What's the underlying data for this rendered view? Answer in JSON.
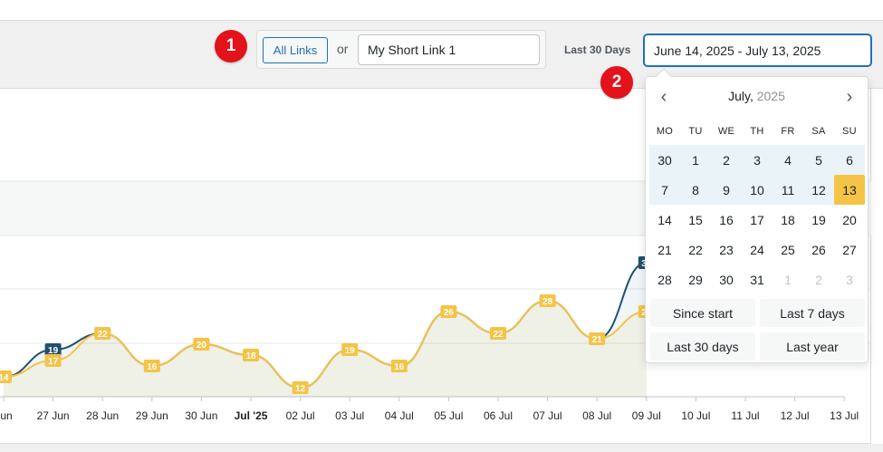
{
  "toolbar": {
    "marker_1": "1",
    "marker_2": "2",
    "all_links_label": "All Links",
    "or_label": "or",
    "link_input_value": "My Short Link 1",
    "range_label": "Last 30 Days",
    "date_range_value": "June 14, 2025 - July 13, 2025"
  },
  "calendar": {
    "month": "July,",
    "year": "2025",
    "prev_icon": "chevron-left",
    "next_icon": "chevron-right",
    "weekdays": [
      "MO",
      "TU",
      "WE",
      "TH",
      "FR",
      "SA",
      "SU"
    ],
    "days": [
      "30",
      "1",
      "2",
      "3",
      "4",
      "5",
      "6",
      "7",
      "8",
      "9",
      "10",
      "11",
      "12",
      "13",
      "14",
      "15",
      "16",
      "17",
      "18",
      "19",
      "20",
      "21",
      "22",
      "23",
      "24",
      "25",
      "26",
      "27",
      "28",
      "29",
      "30",
      "31",
      "1",
      "2",
      "3"
    ],
    "presets": [
      "Since start",
      "Last 7 days",
      "Last 30 days",
      "Last year"
    ]
  },
  "colors": {
    "accent": "#2271b1",
    "highlight": "#f5c346",
    "series_primary": "#21506e",
    "series_secondary": "#f5c346",
    "marker": "#e3121b"
  },
  "chart_data": {
    "type": "line",
    "categories": [
      "Jun",
      "27 Jun",
      "28 Jun",
      "29 Jun",
      "30 Jun",
      "Jul '25",
      "02 Jul",
      "03 Jul",
      "04 Jul",
      "05 Jul",
      "06 Jul",
      "07 Jul",
      "08 Jul",
      "09 Jul",
      "10 Jul",
      "11 Jul",
      "12 Jul",
      "13 Jul"
    ],
    "series": [
      {
        "color": "#21506e",
        "values": [
          14,
          19,
          22,
          16,
          20,
          18,
          12,
          19,
          16,
          26,
          22,
          28,
          21,
          35,
          null,
          null,
          null,
          null
        ]
      },
      {
        "color": "#f5c346",
        "values": [
          14,
          17,
          22,
          16,
          20,
          18,
          12,
          19,
          16,
          26,
          22,
          28,
          21,
          26,
          null,
          null,
          null,
          null
        ]
      }
    ],
    "ylim": [
      0,
      40
    ],
    "grid": true,
    "legend": "none"
  }
}
